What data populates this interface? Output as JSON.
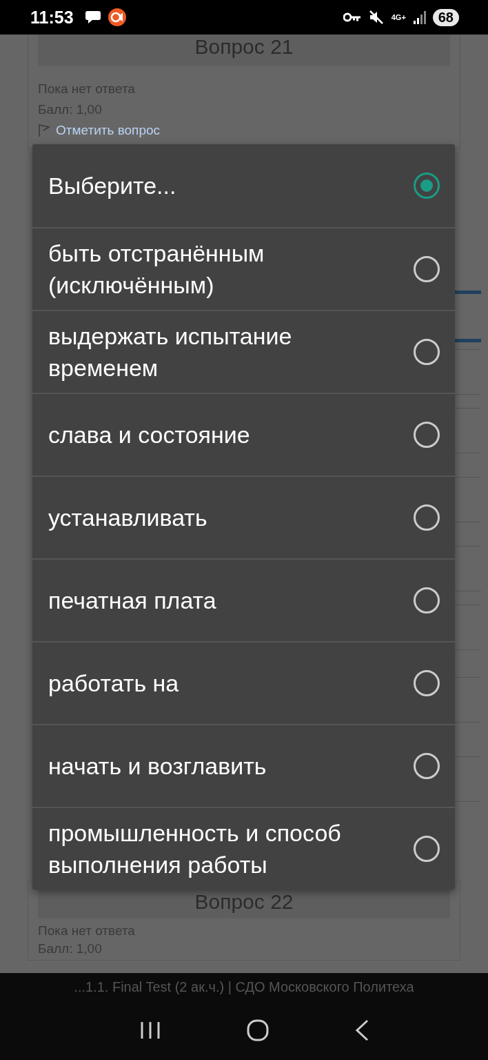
{
  "status_bar": {
    "time": "11:53",
    "network": "4G+",
    "battery": "68"
  },
  "cards": [
    {
      "heading": "Вопрос 21",
      "status": "Пока нет ответа",
      "mark": "Балл: 1,00",
      "flag_link": "Отметить вопрос"
    },
    {
      "heading": "Вопрос 22",
      "status": "Пока нет ответа",
      "mark": "Балл: 1,00"
    }
  ],
  "dialog": {
    "options": [
      {
        "label": "Выберите...",
        "selected": true
      },
      {
        "label": "быть отстранённым (исключённым)",
        "selected": false
      },
      {
        "label": "выдержать испытание временем",
        "selected": false
      },
      {
        "label": "слава и состояние",
        "selected": false
      },
      {
        "label": "устанавливать",
        "selected": false
      },
      {
        "label": "печатная плата",
        "selected": false
      },
      {
        "label": "работать на",
        "selected": false
      },
      {
        "label": "начать и возглавить",
        "selected": false
      },
      {
        "label": "промышленность и способ выполнения работы",
        "selected": false
      }
    ]
  },
  "browser_title": "...1.1. Final Test (2 ак.ч.) | СДО Московского Политеха"
}
